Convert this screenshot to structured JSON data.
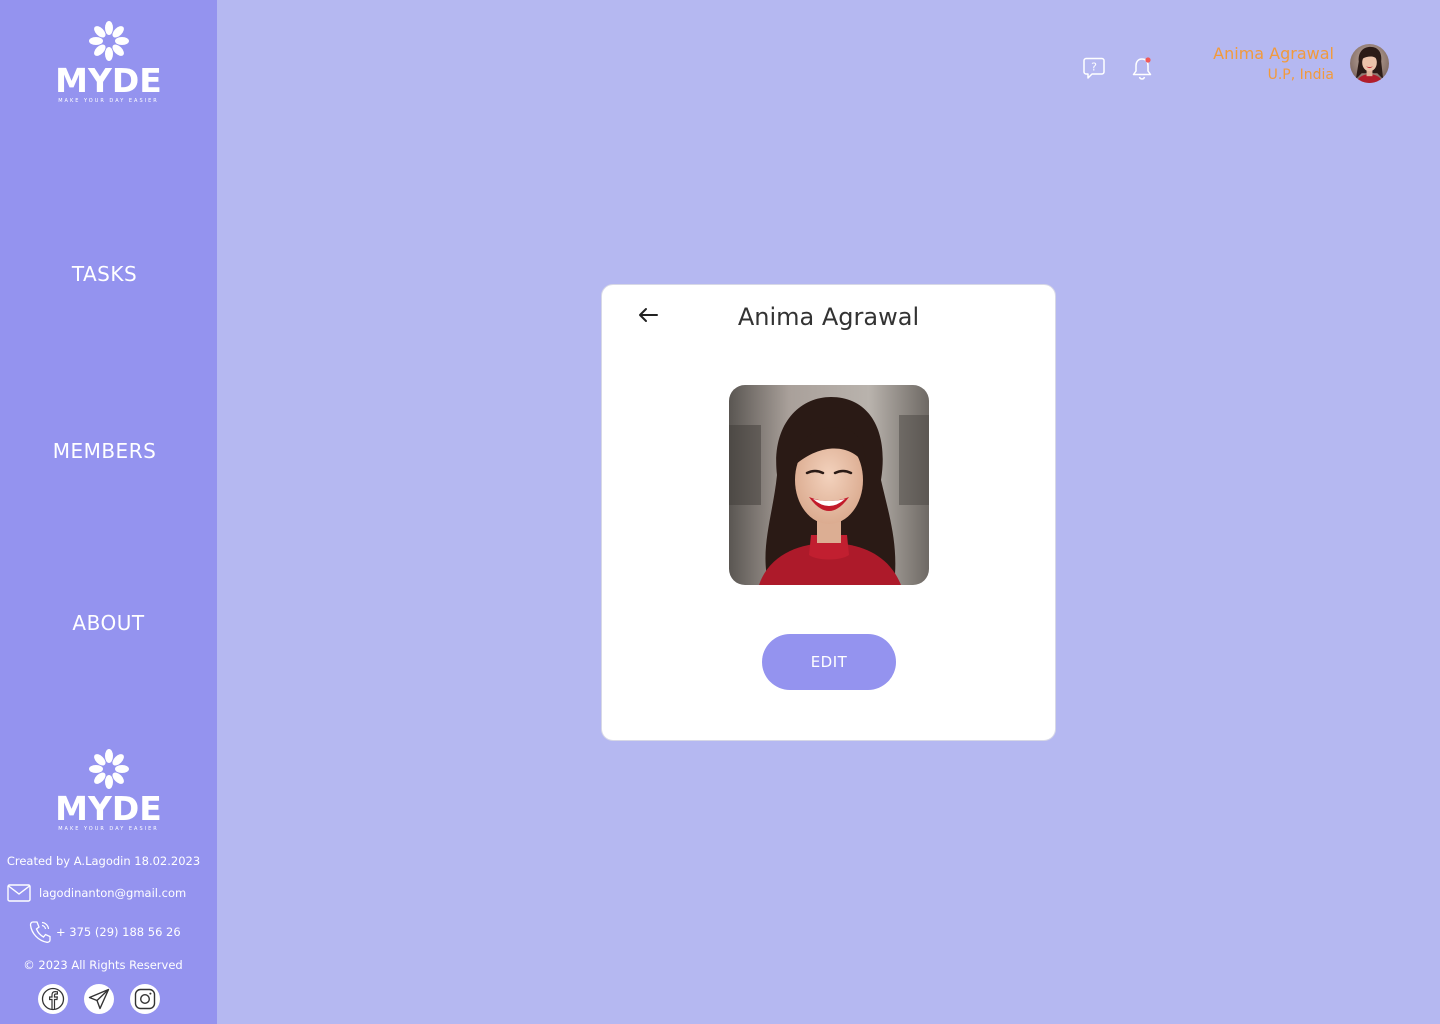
{
  "brand": {
    "name": "MYDE",
    "tagline": "MAKE YOUR DAY EASIER"
  },
  "nav": {
    "items": [
      {
        "label": "TASKS"
      },
      {
        "label": "MEMBERS"
      },
      {
        "label": "ABOUT"
      }
    ]
  },
  "footer": {
    "credit": "Created by A.Lagodin 18.02.2023",
    "email": "lagodinanton@gmail.com",
    "phone": "+ 375 (29) 188 56 26",
    "copyright": "© 2023 All Rights Reserved",
    "socials": [
      "facebook-icon",
      "telegram-icon",
      "instagram-icon"
    ]
  },
  "header": {
    "user_name": "Anima Agrawal",
    "user_location": "U.P, India",
    "icons": [
      "help-chat-icon",
      "bell-icon"
    ]
  },
  "profile_card": {
    "title": "Anima Agrawal",
    "edit_label": "EDIT"
  },
  "colors": {
    "background": "#b5b8f1",
    "sidebar": "#9493ef",
    "accent": "#9493ef",
    "user_text": "#f29a3b",
    "notification_dot": "#f05a5a"
  }
}
